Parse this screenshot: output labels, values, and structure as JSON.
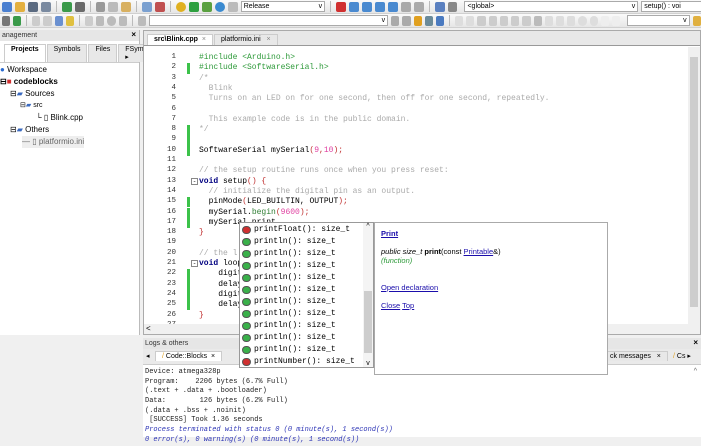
{
  "toolbar": {
    "build_target": "Release",
    "scope": "<global>",
    "function": "setup() : voi",
    "search_value": ""
  },
  "management": {
    "title": "anagement",
    "close": "×",
    "tabs": [
      "Projects",
      "Symbols",
      "Files",
      "FSym ▸"
    ],
    "tree": {
      "workspace": "Workspace",
      "project": "codeblocks",
      "sources": "Sources",
      "src": "src",
      "file1": "Blink.cpp",
      "others": "Others",
      "file2": "platformio.ini"
    }
  },
  "editor": {
    "tabs": [
      {
        "label": "src\\Blink.cpp",
        "close": "×"
      },
      {
        "label": "platformio.ini",
        "close": "×"
      }
    ],
    "lines": [
      [
        [
          "#include <Arduino.h>",
          "pp"
        ]
      ],
      [
        [
          "#include <SoftwareSerial.h>",
          "pp"
        ]
      ],
      [
        [
          "/*",
          "cm"
        ]
      ],
      [
        [
          "  Blink",
          "cm"
        ]
      ],
      [
        [
          "  Turns on an LED on for one second, then off for one second, repeatedly.",
          "cm"
        ]
      ],
      [],
      [
        [
          "  This example code is in the public domain.",
          "cm"
        ]
      ],
      [
        [
          "*/",
          "cm"
        ]
      ],
      [],
      [
        [
          "SoftwareSerial mySerial",
          ""
        ],
        [
          "(",
          "op"
        ],
        [
          "9",
          "nm"
        ],
        [
          ",",
          "op"
        ],
        [
          "10",
          "nm"
        ],
        [
          ");",
          "op"
        ]
      ],
      [],
      [
        [
          "// the setup routine runs once when you press reset:",
          "cm"
        ]
      ],
      [
        [
          "void",
          "kw"
        ],
        [
          " setup",
          ""
        ],
        [
          "() {",
          "op"
        ]
      ],
      [
        [
          "  // initialize the digital pin as an output.",
          "cm"
        ]
      ],
      [
        [
          "  pinMode",
          ""
        ],
        [
          "(",
          "op"
        ],
        [
          "LED_BUILTIN, OUTPUT",
          ""
        ],
        [
          ");",
          "op"
        ]
      ],
      [
        [
          "  mySerial.",
          ""
        ],
        [
          "begin",
          "fn"
        ],
        [
          "(",
          "op"
        ],
        [
          "9600",
          "nm"
        ],
        [
          ");",
          "op"
        ]
      ],
      [
        [
          "  mySerial.print",
          ""
        ]
      ],
      [
        [
          "}",
          "op"
        ]
      ],
      [],
      [
        [
          "// the l",
          "cm"
        ]
      ],
      [
        [
          "void",
          "kw"
        ],
        [
          " loop",
          ""
        ]
      ],
      [
        [
          "    digit",
          ""
        ]
      ],
      [
        [
          "    delay",
          ""
        ]
      ],
      [
        [
          "    digit",
          ""
        ]
      ],
      [
        [
          "    delay",
          ""
        ]
      ],
      [
        [
          "}",
          "op"
        ]
      ],
      []
    ],
    "changed_lines": [
      2,
      8,
      9,
      10,
      15,
      16,
      17,
      22,
      23,
      24,
      25
    ],
    "fold_lines": [
      13,
      21
    ]
  },
  "autocomplete": {
    "items": [
      {
        "label": "printFloat(): size_t",
        "status": "red"
      },
      {
        "label": "println(): size_t",
        "status": "green"
      },
      {
        "label": "println(): size_t",
        "status": "green"
      },
      {
        "label": "println(): size_t",
        "status": "green"
      },
      {
        "label": "println(): size_t",
        "status": "green"
      },
      {
        "label": "println(): size_t",
        "status": "green"
      },
      {
        "label": "println(): size_t",
        "status": "green"
      },
      {
        "label": "println(): size_t",
        "status": "green"
      },
      {
        "label": "println(): size_t",
        "status": "green"
      },
      {
        "label": "println(): size_t",
        "status": "green"
      },
      {
        "label": "println(): size_t",
        "status": "green"
      },
      {
        "label": "printNumber(): size_t",
        "status": "red"
      }
    ]
  },
  "doc": {
    "title": "Print",
    "sig_prefix": "public size_t ",
    "sig_name": "print",
    "sig_mid": "(const ",
    "sig_link": "Printable",
    "sig_suffix": "&)",
    "kind": "(function)",
    "open_decl": "Open declaration",
    "close": "Close",
    "top": "Top"
  },
  "logs": {
    "title": "Logs & others",
    "close": "×",
    "tabs": [
      "Code::Blocks",
      "ck messages",
      "Cs ▸"
    ],
    "lines": [
      {
        "t": "Device: atmega328p",
        "c": ""
      },
      {
        "t": "Program:    2206 bytes (6.7% Full)",
        "c": ""
      },
      {
        "t": "(.text + .data + .bootloader)",
        "c": ""
      },
      {
        "t": "Data:        126 bytes (6.2% Full)",
        "c": ""
      },
      {
        "t": "(.data + .bss + .noinit)",
        "c": ""
      },
      {
        "t": " [SUCCESS] Took 1.36 seconds",
        "c": ""
      },
      {
        "t": "Process terminated with status 0 (0 minute(s), 1 second(s))",
        "c": "blue"
      },
      {
        "t": "0 error(s), 0 warning(s) (0 minute(s), 1 second(s))",
        "c": "blue"
      }
    ]
  },
  "colors": {
    "change_bar": "#3cc24a",
    "accent_link": "#1a0dab",
    "log_blue": "#2b33b5"
  }
}
